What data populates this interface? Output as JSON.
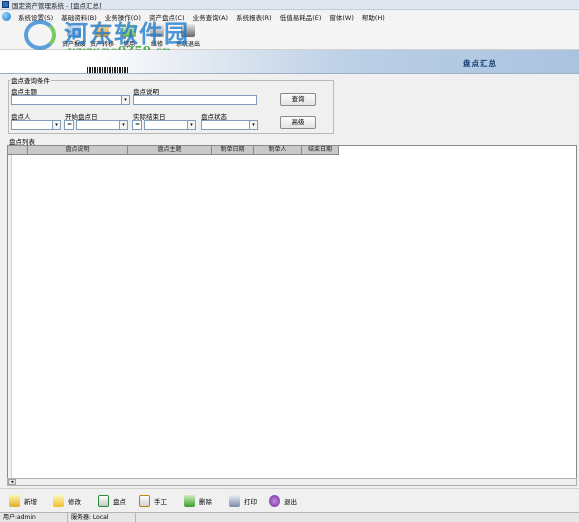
{
  "window": {
    "title": "国定资产管理系统 - [盘点汇总]"
  },
  "menu": [
    "系统设置(S)",
    "基础资料(B)",
    "业务操作(O)",
    "资产盘点(C)",
    "业务查询(A)",
    "系统报表(R)",
    "低值易耗品(E)",
    "窗体(W)",
    "帮助(H)"
  ],
  "toolbar": [
    "资产报废",
    "资产转移",
    "借用",
    "维修",
    "系统退出"
  ],
  "watermark": {
    "title": "河东软件园",
    "url": "www.pc0359.cn"
  },
  "banner": {
    "title": "盘点汇总"
  },
  "query": {
    "group_label": "盘点查询条件",
    "subject_label": "盘点主题",
    "desc_label": "盘点说明",
    "person_label": "盘点人",
    "start_label": "开始盘点日",
    "actual_end_label": "实际结束日",
    "status_label": "盘点状态",
    "start_op": "=",
    "end_op": "=",
    "search_button": "查询",
    "advanced_button": "高级"
  },
  "list": {
    "label": "盘点列表",
    "columns": [
      "盘点说明",
      "盘点主题",
      "制单日期",
      "制单人",
      "结束日期"
    ]
  },
  "bottom": [
    "新增",
    "修改",
    "盘点",
    "手工",
    "删除",
    "打印",
    "退出"
  ],
  "status": {
    "user": "用户:admin",
    "server": "服务器: Local"
  },
  "colors": {
    "banner_title": "#123a70",
    "header_bg": "#c9c9c9"
  }
}
